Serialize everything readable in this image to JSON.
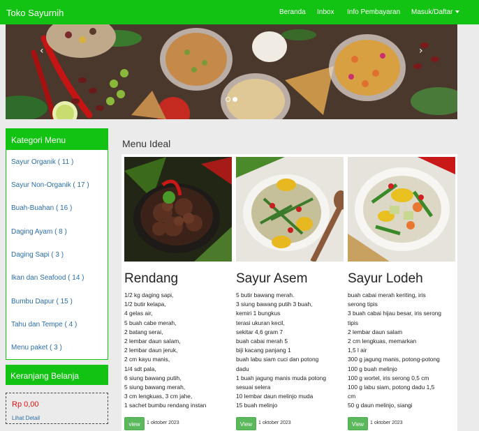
{
  "navbar": {
    "brand": "Toko Sayurnih",
    "links": [
      "Beranda",
      "Inbox",
      "Info Pembayaran"
    ],
    "account_label": "Masuk/Daftar"
  },
  "carousel": {
    "prev_icon": "chevron-left-icon",
    "next_icon": "chevron-right-icon",
    "slide_count": 2,
    "active_slide": 2
  },
  "sidebar": {
    "title": "Kategori Menu",
    "items": [
      "Sayur Organik ( 11 )",
      "Sayur Non-Organik ( 17 )",
      "Buah-Buahan ( 16 )",
      "Daging Ayam ( 8 )",
      "Daging Sapi ( 3 )",
      "Ikan dan Seafood ( 14 )",
      "Bumbu Dapur ( 15 )",
      "Tahu dan Tempe ( 4 )",
      "Menu paket ( 3 )"
    ]
  },
  "cart": {
    "title": "Keranjang Belanja",
    "total": "Rp 0,00",
    "detail_link": "Lihat Detail"
  },
  "main": {
    "title": "Menu Ideal",
    "recipes": [
      {
        "name": "Rendang",
        "ingredients": [
          "1/2 kg daging sapi,",
          "1/2 butir kelapa,",
          "4 gelas air,",
          "5 buah cabe merah,",
          "2 batang serai,",
          "2 lembar daun salam,",
          "2 lembar daun jeruk,",
          "2 cm kayu manis,",
          "1/4 sdt pala,",
          "6 siung bawang putih,",
          "5 siung bawang merah,",
          "3 cm lengkuas, 3 cm jahe,",
          "1 sachet bumbu rendang instan"
        ],
        "button": "view",
        "date": "1 oktober 2023"
      },
      {
        "name": "Sayur Asem",
        "ingredients": [
          "5 butir bawang merah.",
          "3 siung bawang putih 3 buah,",
          "kemiri 1 bungkus",
          "terasi ukuran kecil,",
          "sekitar 4,6 gram 7",
          "buah cabai merah 5",
          "biji kacang panjang 1",
          "buah labu siam cuci dan potong",
          "dadu",
          "1 buah jagung manis muda potong",
          "sesuai selera",
          "10 lembar daun melinjo muda",
          "15 buah melinjo"
        ],
        "button": "View",
        "date": "1 oktober 2023"
      },
      {
        "name": "Sayur Lodeh",
        "ingredients": [
          "buah cabai merah keriting, iris",
          "serong tipis",
          "3 buah cabai hijau besar, iris serong",
          "tipis",
          "2 lembar daun salam",
          "2 cm lengkuas, memarkan",
          "1,5 l air",
          "300 g jagung manis, potong-potong",
          "100 g buah melinjo",
          "100 g wortel, iris serong 0,5 cm",
          "100 g labu siam, potong dadu 1,5",
          "cm",
          "50 g daun melinjo, siangi"
        ],
        "button": "View",
        "date": "1 oktober 2023"
      }
    ]
  },
  "colors": {
    "brand_green": "#13c313",
    "link_blue": "#2a6ea8",
    "price_red": "#e01010",
    "button_green": "#5cb85c"
  }
}
